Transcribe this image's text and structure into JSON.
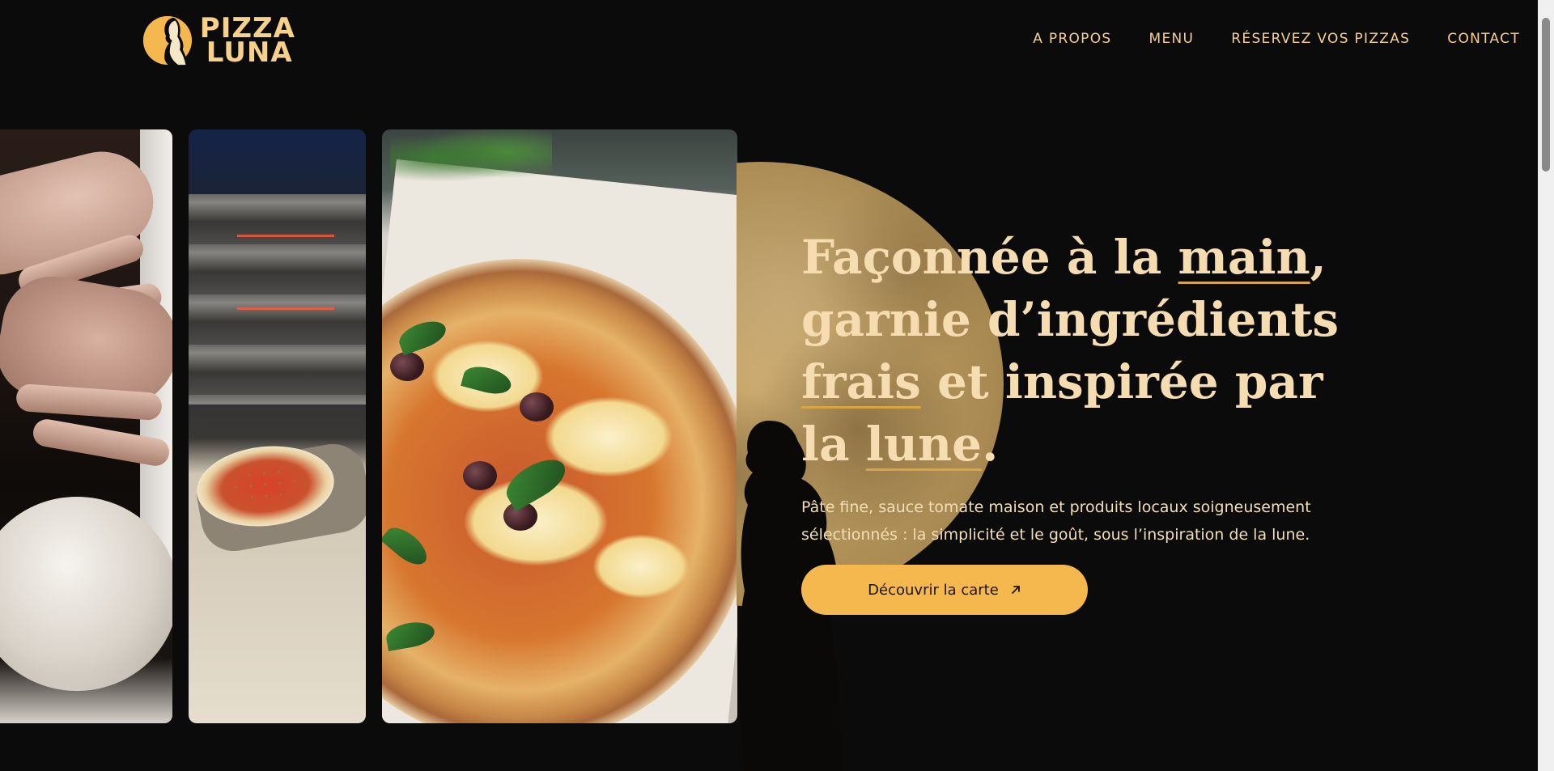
{
  "brand": {
    "line1": "PIZZA",
    "line2": "LUNA",
    "gold": "#f7d08a"
  },
  "nav": {
    "items": [
      {
        "label": "A PROPOS"
      },
      {
        "label": "MENU"
      },
      {
        "label": "RÉSERVEZ VOS PIZZAS"
      },
      {
        "label": "CONTACT"
      }
    ]
  },
  "hero": {
    "title": {
      "p1": "Façonnée à la ",
      "u1": "main",
      "p2": ", garnie d’ingrédients ",
      "u2": "frais",
      "p3": " et inspirée par la ",
      "u3": "lune",
      "p4": "."
    },
    "description": "Pâte fine, sauce tomate maison et produits locaux soigneusement sélectionnés : la simplicité et le goût, sous l’inspiration de la lune.",
    "cta_label": "Découvrir la carte",
    "cta_icon": "arrow-up-right-icon",
    "accent": "#f5b84f",
    "title_color": "#f6ddb1"
  },
  "gallery": {
    "images": [
      {
        "subject": "hands-kneading-dough"
      },
      {
        "subject": "oven-and-pizza-peel"
      },
      {
        "subject": "olive-basil-pizza"
      }
    ]
  },
  "colors": {
    "background": "#0b0b0b",
    "moon": "#b8975c"
  }
}
